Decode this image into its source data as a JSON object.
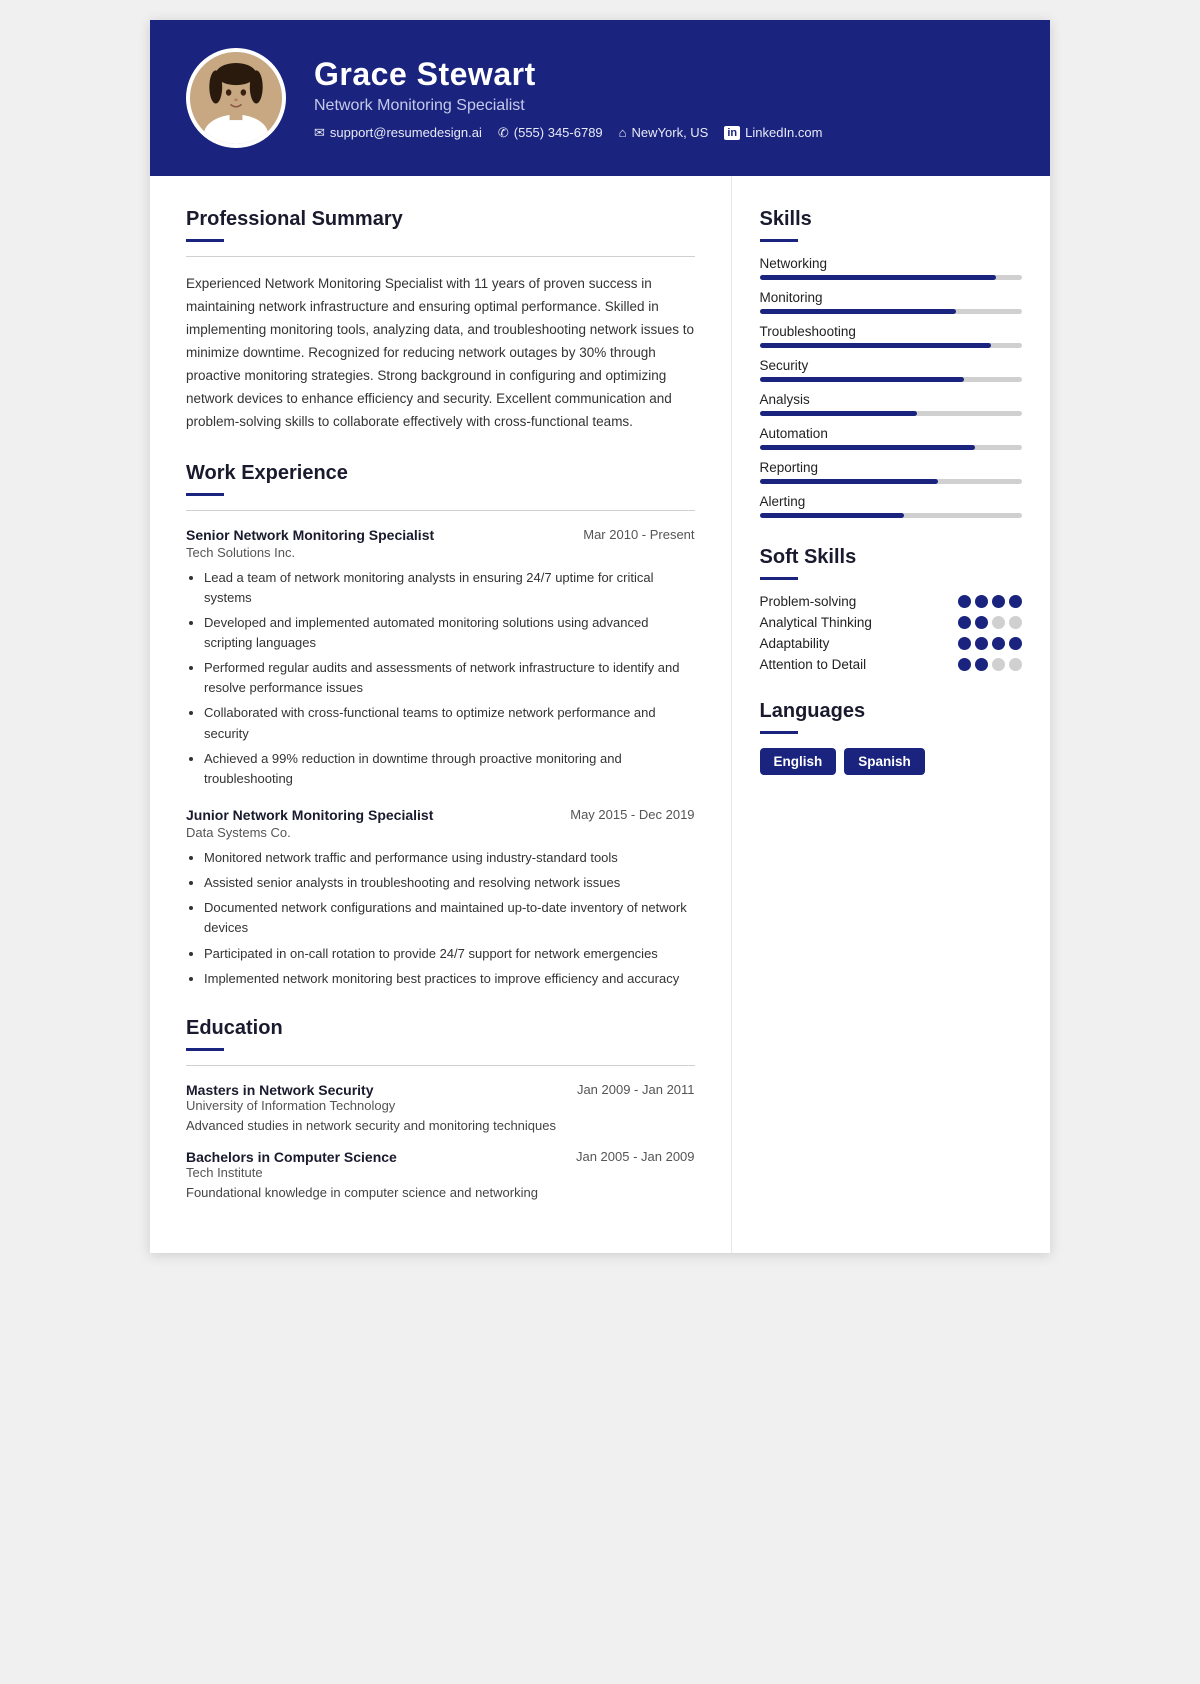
{
  "header": {
    "name": "Grace Stewart",
    "title": "Network Monitoring Specialist",
    "contacts": [
      {
        "icon": "✉",
        "text": "support@resumedesign.ai",
        "name": "email"
      },
      {
        "icon": "✆",
        "text": "(555) 345-6789",
        "name": "phone"
      },
      {
        "icon": "⌂",
        "text": "NewYork, US",
        "name": "location"
      },
      {
        "icon": "in",
        "text": "LinkedIn.com",
        "name": "linkedin"
      }
    ]
  },
  "summary": {
    "section_title": "Professional Summary",
    "text": "Experienced Network Monitoring Specialist with 11 years of proven success in maintaining network infrastructure and ensuring optimal performance. Skilled in implementing monitoring tools, analyzing data, and troubleshooting network issues to minimize downtime. Recognized for reducing network outages by 30% through proactive monitoring strategies. Strong background in configuring and optimizing network devices to enhance efficiency and security. Excellent communication and problem-solving skills to collaborate effectively with cross-functional teams."
  },
  "work": {
    "section_title": "Work Experience",
    "jobs": [
      {
        "title": "Senior Network Monitoring Specialist",
        "date": "Mar 2010 - Present",
        "company": "Tech Solutions Inc.",
        "bullets": [
          "Lead a team of network monitoring analysts in ensuring 24/7 uptime for critical systems",
          "Developed and implemented automated monitoring solutions using advanced scripting languages",
          "Performed regular audits and assessments of network infrastructure to identify and resolve performance issues",
          "Collaborated with cross-functional teams to optimize network performance and security",
          "Achieved a 99% reduction in downtime through proactive monitoring and troubleshooting"
        ]
      },
      {
        "title": "Junior Network Monitoring Specialist",
        "date": "May 2015 - Dec 2019",
        "company": "Data Systems Co.",
        "bullets": [
          "Monitored network traffic and performance using industry-standard tools",
          "Assisted senior analysts in troubleshooting and resolving network issues",
          "Documented network configurations and maintained up-to-date inventory of network devices",
          "Participated in on-call rotation to provide 24/7 support for network emergencies",
          "Implemented network monitoring best practices to improve efficiency and accuracy"
        ]
      }
    ]
  },
  "education": {
    "section_title": "Education",
    "entries": [
      {
        "degree": "Masters in Network Security",
        "date": "Jan 2009 - Jan 2011",
        "institution": "University of Information Technology",
        "description": "Advanced studies in network security and monitoring techniques"
      },
      {
        "degree": "Bachelors in Computer Science",
        "date": "Jan 2005 - Jan 2009",
        "institution": "Tech Institute",
        "description": "Foundational knowledge in computer science and networking"
      }
    ]
  },
  "skills": {
    "section_title": "Skills",
    "items": [
      {
        "name": "Networking",
        "pct": 90
      },
      {
        "name": "Monitoring",
        "pct": 75
      },
      {
        "name": "Troubleshooting",
        "pct": 88
      },
      {
        "name": "Security",
        "pct": 78
      },
      {
        "name": "Analysis",
        "pct": 60
      },
      {
        "name": "Automation",
        "pct": 82
      },
      {
        "name": "Reporting",
        "pct": 68
      },
      {
        "name": "Alerting",
        "pct": 55
      }
    ]
  },
  "soft_skills": {
    "section_title": "Soft Skills",
    "items": [
      {
        "name": "Problem-solving",
        "filled": 4,
        "empty": 0
      },
      {
        "name": "Analytical Thinking",
        "filled": 2,
        "empty": 2
      },
      {
        "name": "Adaptability",
        "filled": 4,
        "empty": 0
      },
      {
        "name": "Attention to Detail",
        "filled": 2,
        "empty": 2
      }
    ]
  },
  "languages": {
    "section_title": "Languages",
    "items": [
      "English",
      "Spanish"
    ]
  }
}
